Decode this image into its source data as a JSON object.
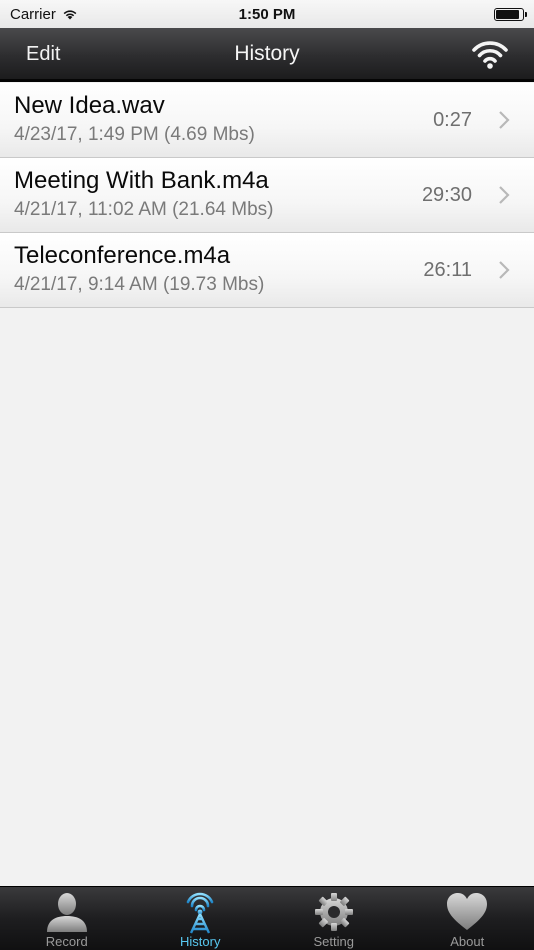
{
  "status_bar": {
    "carrier": "Carrier",
    "time": "1:50 PM",
    "battery_level": 0.9
  },
  "nav": {
    "edit_label": "Edit",
    "title": "History",
    "right_icon": "wifi-icon"
  },
  "recordings": [
    {
      "title": "New Idea.wav",
      "subtitle": "4/23/17, 1:49 PM (4.69 Mbs)",
      "duration": "0:27"
    },
    {
      "title": "Meeting With Bank.m4a",
      "subtitle": "4/21/17, 11:02 AM (21.64 Mbs)",
      "duration": "29:30"
    },
    {
      "title": "Teleconference.m4a",
      "subtitle": "4/21/17, 9:14 AM (19.73 Mbs)",
      "duration": "26:11"
    }
  ],
  "tabs": [
    {
      "label": "Record",
      "icon": "person-icon",
      "active": false
    },
    {
      "label": "History",
      "icon": "antenna-icon",
      "active": true
    },
    {
      "label": "Setting",
      "icon": "gear-icon",
      "active": false
    },
    {
      "label": "About",
      "icon": "heart-icon",
      "active": false
    }
  ],
  "colors": {
    "active_tab": "#58c8f0",
    "nav_bar": "#2d2d2f",
    "background": "#f2f2f2"
  }
}
